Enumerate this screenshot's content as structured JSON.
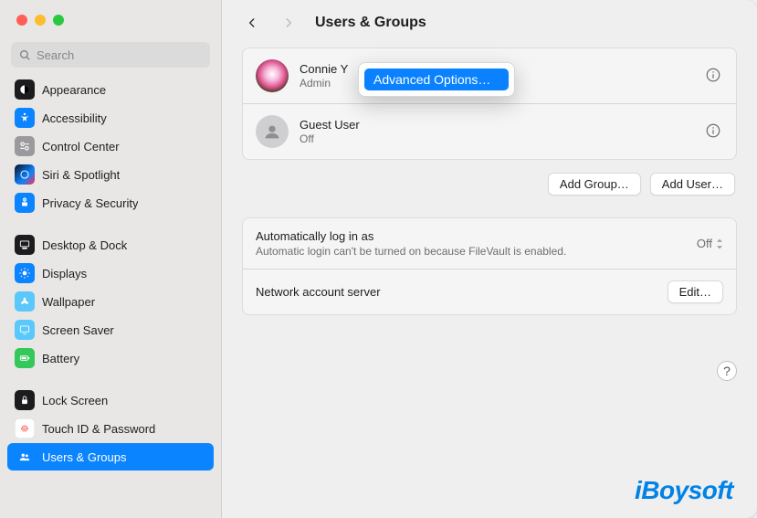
{
  "window": {
    "title": "Users & Groups"
  },
  "search": {
    "placeholder": "Search"
  },
  "sidebar": {
    "groups": [
      [
        {
          "key": "appearance",
          "label": "Appearance"
        },
        {
          "key": "accessibility",
          "label": "Accessibility"
        },
        {
          "key": "control",
          "label": "Control Center"
        },
        {
          "key": "siri",
          "label": "Siri & Spotlight"
        },
        {
          "key": "privacy",
          "label": "Privacy & Security"
        }
      ],
      [
        {
          "key": "desktop",
          "label": "Desktop & Dock"
        },
        {
          "key": "displays",
          "label": "Displays"
        },
        {
          "key": "wallpaper",
          "label": "Wallpaper"
        },
        {
          "key": "screensaver",
          "label": "Screen Saver"
        },
        {
          "key": "battery",
          "label": "Battery"
        }
      ],
      [
        {
          "key": "lock",
          "label": "Lock Screen"
        },
        {
          "key": "touchid",
          "label": "Touch ID & Password"
        },
        {
          "key": "users",
          "label": "Users & Groups",
          "selected": true
        }
      ]
    ]
  },
  "users": [
    {
      "name": "Connie Y",
      "role": "Admin",
      "avatar": "connie"
    },
    {
      "name": "Guest User",
      "role": "Off",
      "avatar": "guest"
    }
  ],
  "context_menu": {
    "item": "Advanced Options…"
  },
  "buttons": {
    "add_group": "Add Group…",
    "add_user": "Add User…",
    "edit": "Edit…"
  },
  "settings": {
    "auto_login": {
      "title": "Automatically log in as",
      "value": "Off",
      "note": "Automatic login can't be turned on because FileVault is enabled."
    },
    "network_server": {
      "title": "Network account server"
    }
  },
  "help_glyph": "?",
  "watermark": "iBoysoft"
}
